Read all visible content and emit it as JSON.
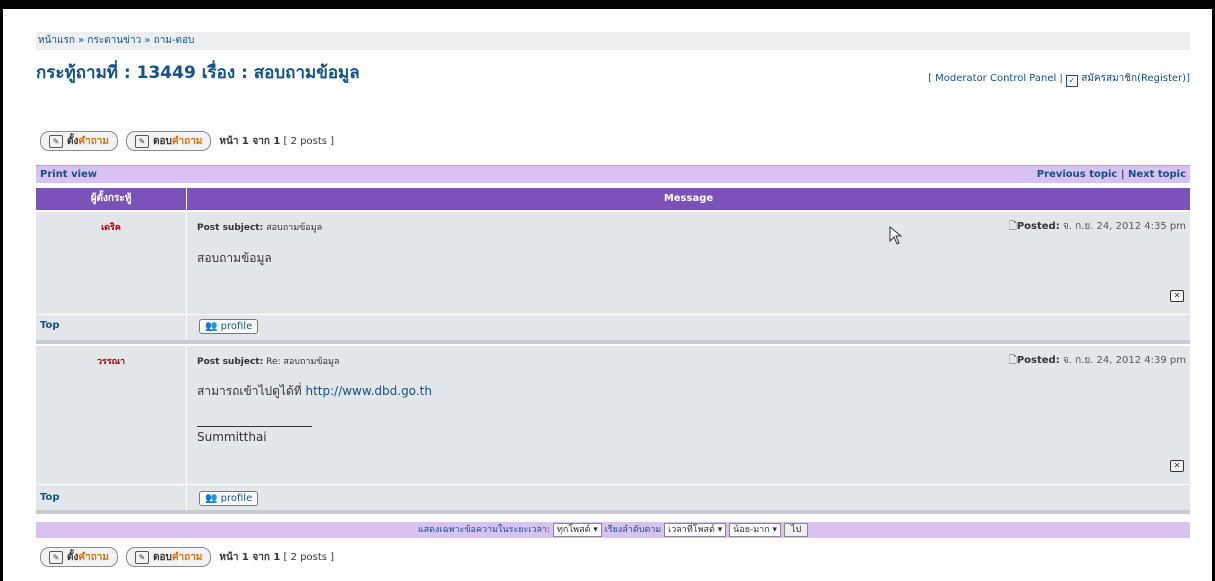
{
  "breadcrumb": "หน้าแรก » กระดานข่าว » ถาม-ตอบ",
  "title": "กระทู้ถามที่ : 13449 เรื่อง : สอบถามข้อมูล",
  "mod_panel": "[ Moderator Control Panel |",
  "register": "สมัครสมาชิก(Register)]",
  "buttons": {
    "new_topic_prefix": "ตั้ง",
    "new_topic_suffix": "คำถาม",
    "reply_prefix": "ตอบ",
    "reply_suffix": "คำถาม"
  },
  "pagination": {
    "label": "หน้า 1 จาก 1",
    "posts": "[ 2 posts ]"
  },
  "print_view": "Print view",
  "topic_nav": "Previous topic | Next topic",
  "table_header": {
    "author": "ผู้ตั้งกระทู้",
    "message": "Message"
  },
  "posts": [
    {
      "author": "เดริค",
      "subject_label": "Post subject:",
      "subject": "สอบถามข้อมูล",
      "posted_label": "Posted:",
      "posted": "จ. ก.ย. 24, 2012 4:35 pm",
      "body": "สอบถามข้อมูล",
      "top": "Top",
      "profile": "profile"
    },
    {
      "author": "วรรณา",
      "subject_label": "Post subject:",
      "subject": "Re: สอบถามข้อมูล",
      "posted_label": "Posted:",
      "posted": "จ. ก.ย. 24, 2012 4:39 pm",
      "body_text": "สามารถเข้าไปดูได้ที่",
      "body_link": "http://www.dbd.go.th",
      "signature": "Summitthai",
      "top": "Top",
      "profile": "profile"
    }
  ],
  "filter": {
    "label": "แสดงเฉพาะข้อความในระยะเวลา:",
    "period": "ทุกโพสต์",
    "sort_label": "เรียงลำดับตาม",
    "sort_by": "เวลาที่โพสต์",
    "order": "น้อย-มาก",
    "go": "ไป"
  }
}
